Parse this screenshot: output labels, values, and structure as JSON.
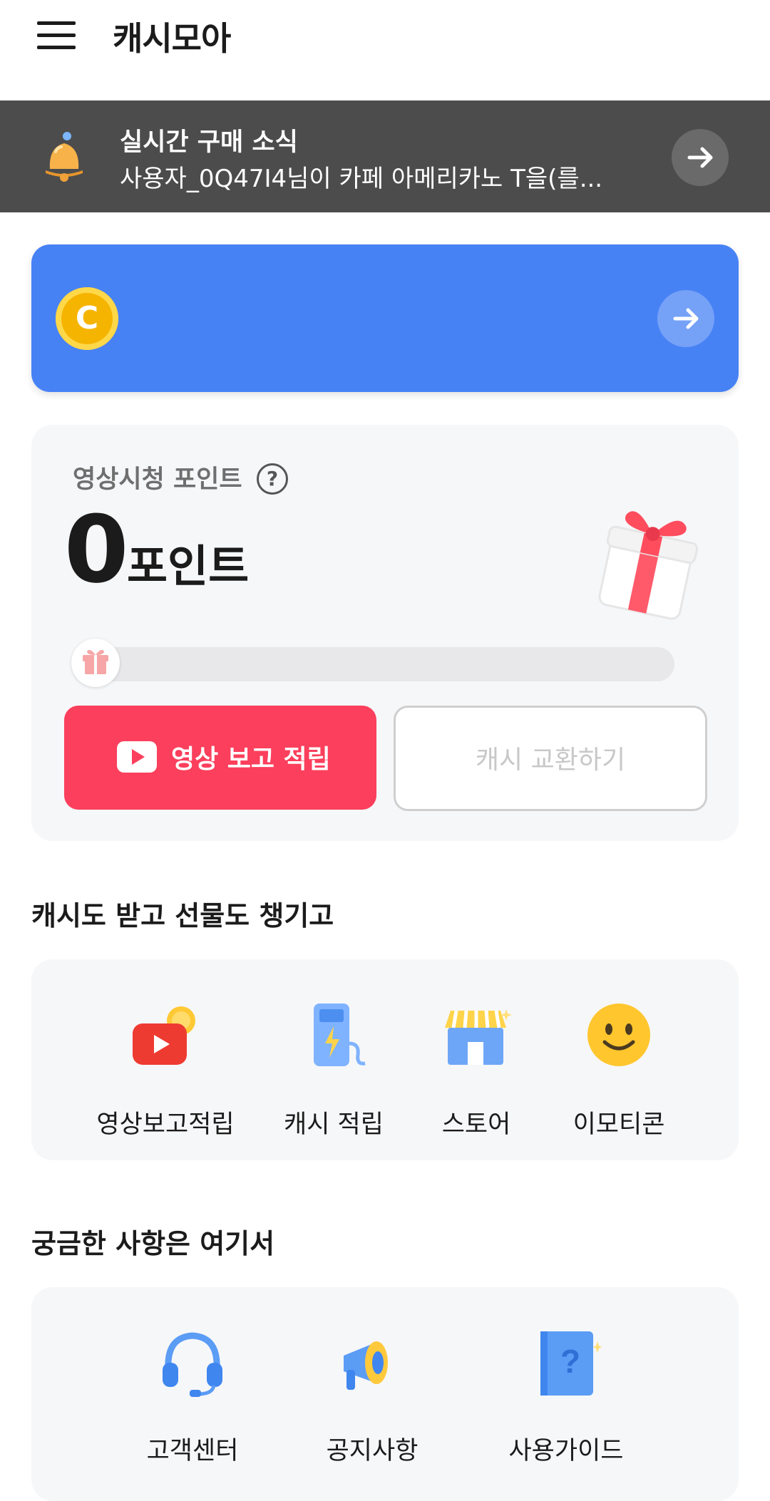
{
  "header": {
    "title": "캐시모아",
    "menu_icon": "hamburger-menu-icon"
  },
  "news": {
    "title": "실시간 구매 소식",
    "message": "사용자_0Q47I4님이 카페 아메리카노 T을(를...",
    "icon": "bell-icon"
  },
  "banner": {
    "coin_letter": "C",
    "icon": "coin-icon"
  },
  "points": {
    "label": "영상시청 포인트",
    "help": "?",
    "value": "0",
    "unit": "포인트",
    "progress": 0,
    "watch_button": "영상 보고 적립",
    "exchange_button": "캐시 교환하기"
  },
  "earn_section": {
    "title": "캐시도 받고 선물도 챙기고",
    "items": [
      {
        "label": "영상보고적립",
        "icon": "video-play-icon"
      },
      {
        "label": "캐시 적립",
        "icon": "charger-icon"
      },
      {
        "label": "스토어",
        "icon": "store-icon"
      },
      {
        "label": "이모티콘",
        "icon": "smiley-icon"
      }
    ]
  },
  "help_section": {
    "title": "궁금한 사항은 여기서",
    "items": [
      {
        "label": "고객센터",
        "icon": "headset-icon"
      },
      {
        "label": "공지사항",
        "icon": "megaphone-icon"
      },
      {
        "label": "사용가이드",
        "icon": "guide-book-icon"
      }
    ]
  },
  "colors": {
    "accent_blue": "#4782f5",
    "accent_red": "#fb3f5c",
    "news_bg": "#4c4c4c"
  }
}
